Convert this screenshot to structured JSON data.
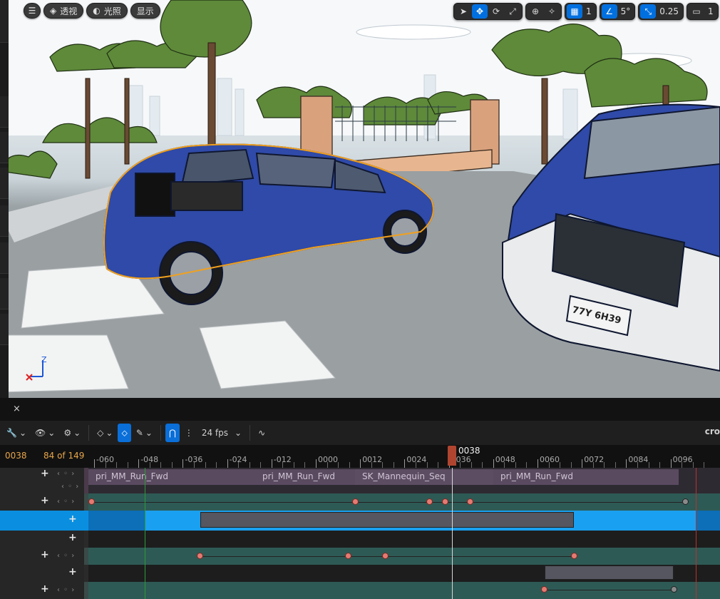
{
  "viewport_toolbar": {
    "menu_icon": "hamburger-icon",
    "perspective_label": "透视",
    "lighting_label": "光照",
    "show_label": "显示",
    "grid_value": "1",
    "angle_value": "5°",
    "scale_value": "0.25",
    "camera_speed_value": "1"
  },
  "scene": {
    "license_plate": "77Y 6H39",
    "axis_z": "Z"
  },
  "sequencer": {
    "close_label": "×",
    "fps_label": "24 fps",
    "crop_label": "cro",
    "current_frame": "0038",
    "frame_count": "84 of 149",
    "playhead_label": "0038",
    "ruler_labels": [
      "-060",
      "-048",
      "-036",
      "-024",
      "-012",
      "0000",
      "0012",
      "0024",
      "0036",
      "0048",
      "0060",
      "0072",
      "0084",
      "0096"
    ],
    "sections": [
      "pri_MM_Run_Fwd",
      "pri_MM_Run_Fwd",
      "SK_Mannequin_Seq",
      "pri_MM_Run_Fwd"
    ],
    "colors": {
      "accent": "#0a6fd8",
      "playhead": "#b0452f",
      "key": "#e57a72",
      "section": "#5a4a60",
      "track_teal": "#2e5a55",
      "selected_row": "#0a8fe0"
    }
  }
}
